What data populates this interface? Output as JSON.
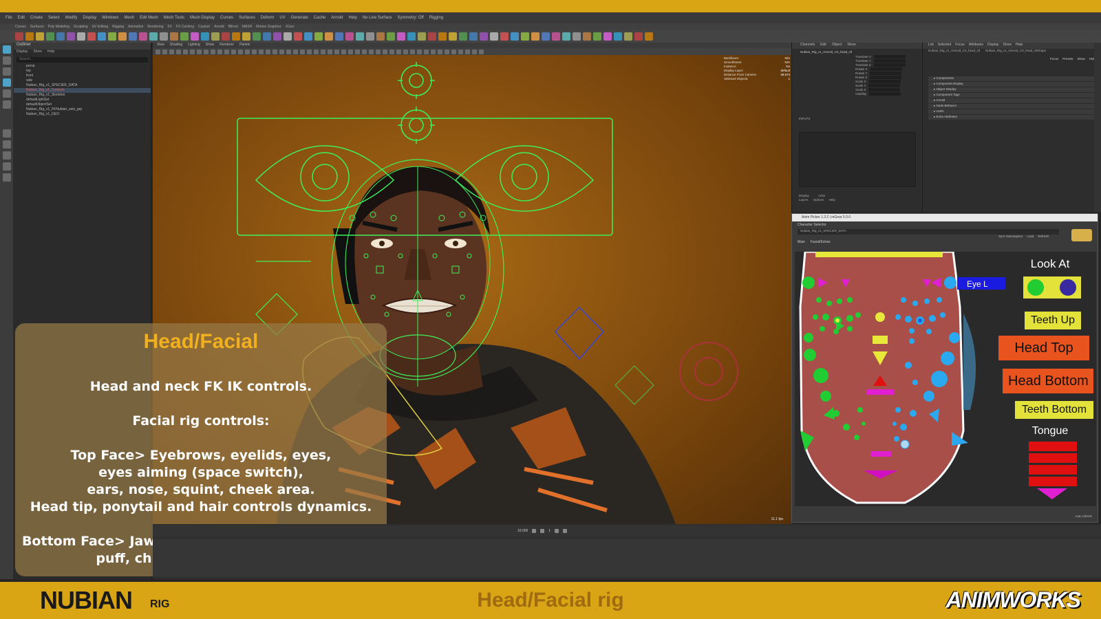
{
  "window": {
    "title": "Autodesk Maya"
  },
  "menubar": {
    "items": [
      "File",
      "Edit",
      "Create",
      "Select",
      "Modify",
      "Display",
      "Windows",
      "Mesh",
      "Edit Mesh",
      "Mesh Tools",
      "Mesh Display",
      "Curves",
      "Surfaces",
      "Deform",
      "UV",
      "Generate",
      "Cache",
      "Arnold",
      "Help"
    ],
    "live_surface": "No Live Surface",
    "symmetry": "Symmetry: Off",
    "workspace": "Rigging"
  },
  "shelf_tabs": [
    "Curves",
    "Surfaces",
    "Poly Modeling",
    "Sculpting",
    "UV Editing",
    "Rigging",
    "Animation",
    "Rendering",
    "FX",
    "FX Caching",
    "Custom",
    "Arnold",
    "Bifrost",
    "MASH",
    "Motion Graphics",
    "XGen"
  ],
  "outliner": {
    "title": "Outliner",
    "menu": [
      "Display",
      "Show",
      "Help"
    ],
    "search_placeholder": "Search...",
    "items": [
      {
        "label": "persp",
        "selected": false
      },
      {
        "label": "top",
        "selected": false
      },
      {
        "label": "front",
        "selected": false
      },
      {
        "label": "side",
        "selected": false
      },
      {
        "label": "Nubian_Rig_v1_SPECIER_DATA",
        "selected": false
      },
      {
        "label": "Nubian_Rig_v1_Controls",
        "selected": true
      },
      {
        "label": "Nubian_Rig_v1_Skeleton",
        "selected": false
      },
      {
        "label": "defaultLightSet",
        "selected": false
      },
      {
        "label": "defaultObjectSet",
        "selected": false
      },
      {
        "label": "Nubian_Rig_v1_FKNubian_sets_grp",
        "selected": false
      },
      {
        "label": "Nubian_Rig_v1_GEO",
        "selected": false
      }
    ]
  },
  "viewport": {
    "menu": [
      "View",
      "Shading",
      "Lighting",
      "Show",
      "Renderer",
      "Panels"
    ],
    "camera": "persp",
    "fps": "11.1 fps",
    "hud": [
      {
        "k": "Backfaces:",
        "v": "N/A"
      },
      {
        "k": "Smoothness:",
        "v": "N/A"
      },
      {
        "k": "Instance:",
        "v": "No"
      },
      {
        "k": "Display Layer:",
        "v": "default"
      },
      {
        "k": "Distance From Camera:",
        "v": "38.673"
      },
      {
        "k": "Selected Objects:",
        "v": "1"
      }
    ]
  },
  "info_panel": {
    "title": "Head/Facial",
    "lines": [
      "Head and neck FK IK controls.",
      "Facial rig controls:",
      "Top Face> Eyebrows, eyelids, eyes,",
      "eyes aiming (space switch),",
      "ears, nose, squint, cheek area.",
      "Head tip, ponytail and hair controls dynamics.",
      "Bottom Face> Jaw, mouth, lips, tongue (springs)",
      "puff, chin and adam’s apple."
    ]
  },
  "channel_box": {
    "menu": [
      "Channels",
      "Edit",
      "Object",
      "Show"
    ],
    "object": "Nubian_Rig_v1_Ovevid_C0_head_ctl",
    "channels": [
      "Translate X",
      "Translate Y",
      "Translate Z",
      "Rotate X",
      "Rotate Y",
      "Rotate Z",
      "Scale X",
      "Scale Y",
      "Scale Z",
      "Visibility"
    ],
    "inputs_label": "INPUTS",
    "tabs": [
      "Display",
      "Anim"
    ],
    "tab_menu": [
      "Layers",
      "Options",
      "Help"
    ]
  },
  "attr_editor": {
    "menu": [
      "List",
      "Selected",
      "Focus",
      "Attributes",
      "Display",
      "Show",
      "Help"
    ],
    "tabs": [
      "Nubian_Rig_v1_Ovevid_C0_head_ctl",
      "Nubian_Rig_v1_Ovevid_C0_head_ctlShape"
    ],
    "buttons": [
      "Focus",
      "Presets",
      "Show",
      "Hide"
    ],
    "sections": [
      "Components",
      "Component Display",
      "Object Display",
      "Component Tags",
      "Arnold",
      "Node Behavior",
      "UUID",
      "Extra Attributes"
    ]
  },
  "picker": {
    "title": "Anim Picker 1.3.2 | mGear 5.0.0",
    "character_selector_label": "Character Selector",
    "character": "Nubian_Rig_v1_SPECIER_DATA",
    "tabs": [
      "Main",
      "Facial/Extras"
    ],
    "options": [
      "Sync Namespace",
      "Load",
      "Refresh"
    ],
    "auto_refresh": "Auto refresh",
    "eye_label": "Eye L",
    "look_at_label": "Look At",
    "buttons": {
      "teeth_up": "Teeth Up",
      "head_top": "Head Top",
      "head_bottom": "Head Bottom",
      "teeth_bottom": "Teeth Bottom"
    },
    "tongue_label": "Tongue",
    "colors": {
      "yellow": "#e2e23a",
      "orange_red": "#e8531e",
      "red": "#e01010",
      "green": "#22cc33",
      "blue": "#1a5fe0",
      "cyan": "#2aa8f0",
      "magenta": "#e020d0"
    }
  },
  "timeline": {
    "current_frame": "1",
    "range_label": "10.000"
  },
  "banner": {
    "brand_main": "NUBIAN",
    "brand_small": "RIG",
    "center": "Head/Facial rig",
    "right": "ANIMWORKS"
  }
}
